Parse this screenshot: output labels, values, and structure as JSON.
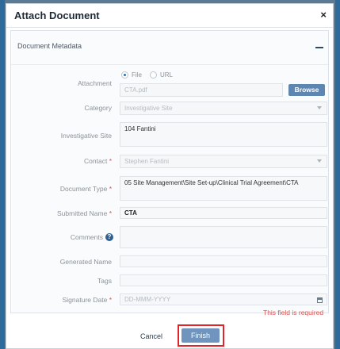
{
  "dialog": {
    "title": "Attach Document",
    "close_label": "×"
  },
  "section": {
    "title": "Document Metadata",
    "collapse_label": "−"
  },
  "form": {
    "attachment": {
      "label": "Attachment",
      "options": [
        "File",
        "URL"
      ],
      "selected": "File",
      "value": "CTA.pdf",
      "browse_label": "Browse"
    },
    "category": {
      "label": "Category",
      "value": "Investigative Site"
    },
    "investigative_site": {
      "label": "Investigative Site",
      "value": "104 Fantini"
    },
    "contact": {
      "label": "Contact",
      "required": "*",
      "value": "Stephen Fantini"
    },
    "document_type": {
      "label": "Document Type",
      "required": "*",
      "value": "05 Site Management\\Site Set-up\\Clinical Trial Agreement\\CTA"
    },
    "submitted_name": {
      "label": "Submitted Name",
      "required": "*",
      "value": "CTA"
    },
    "comments": {
      "label": "Comments",
      "value": "",
      "help_label": "?"
    },
    "generated_name": {
      "label": "Generated Name",
      "value": ""
    },
    "tags": {
      "label": "Tags",
      "value": ""
    },
    "signature_date": {
      "label": "Signature Date",
      "required": "*",
      "placeholder": "DD-MMM-YYYY",
      "error": "This field is required"
    }
  },
  "footer": {
    "cancel_label": "Cancel",
    "finish_label": "Finish"
  },
  "colors": {
    "accent": "#5d86b1",
    "required": "#d9534f",
    "highlight": "#e0242a"
  }
}
